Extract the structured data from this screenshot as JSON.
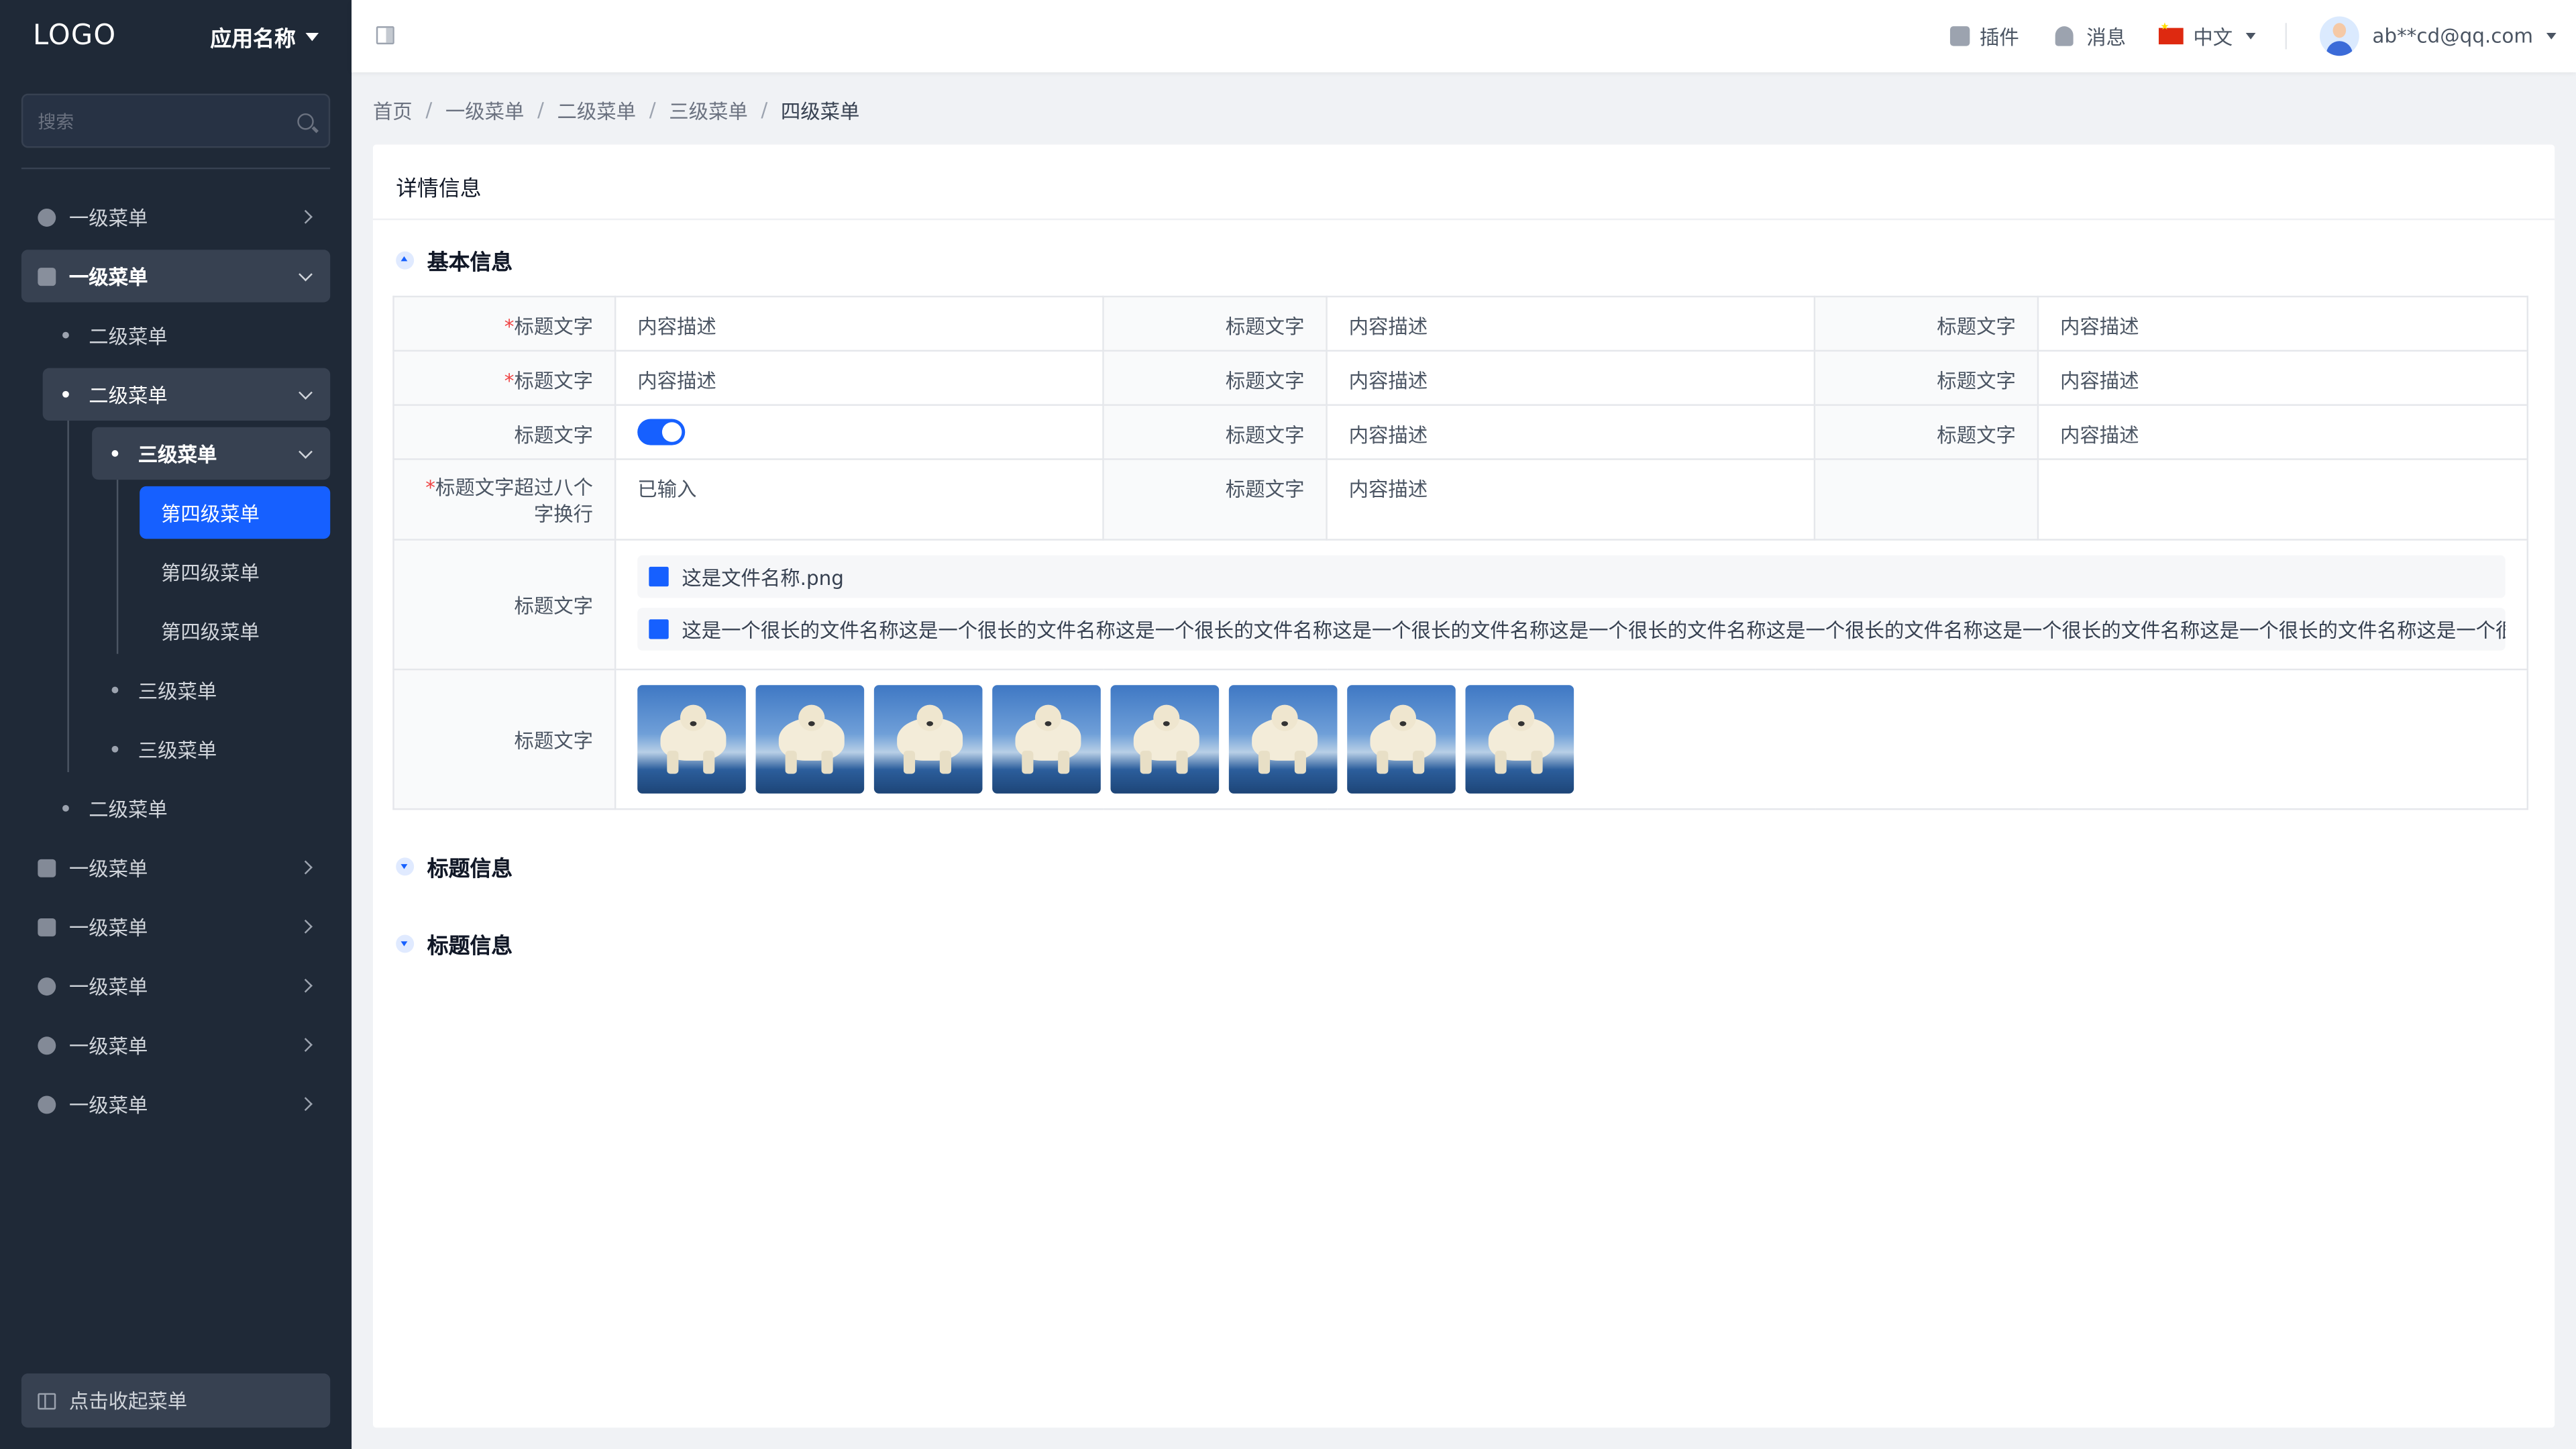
{
  "sidebar": {
    "logo": "LOGO",
    "app_name": "应用名称",
    "search_placeholder": "搜索",
    "items": [
      {
        "label": "一级菜单"
      },
      {
        "label": "一级菜单"
      },
      {
        "label": "二级菜单"
      },
      {
        "label": "二级菜单"
      },
      {
        "label": "三级菜单"
      },
      {
        "label": "第四级菜单"
      },
      {
        "label": "第四级菜单"
      },
      {
        "label": "第四级菜单"
      },
      {
        "label": "三级菜单"
      },
      {
        "label": "三级菜单"
      },
      {
        "label": "二级菜单"
      },
      {
        "label": "一级菜单"
      },
      {
        "label": "一级菜单"
      },
      {
        "label": "一级菜单"
      },
      {
        "label": "一级菜单"
      },
      {
        "label": "一级菜单"
      }
    ],
    "collapse_label": "点击收起菜单"
  },
  "header": {
    "plugins": "插件",
    "messages": "消息",
    "language": "中文",
    "user": "ab**cd@qq.com"
  },
  "breadcrumb": [
    "首页",
    "一级菜单",
    "二级菜单",
    "三级菜单",
    "四级菜单"
  ],
  "card": {
    "title": "详情信息",
    "section_basic": "基本信息",
    "section_2": "标题信息",
    "section_3": "标题信息",
    "rows": [
      {
        "l1": "标题文字",
        "v1": "内容描述",
        "l2": "标题文字",
        "v2": "内容描述",
        "l3": "标题文字",
        "v3": "内容描述"
      },
      {
        "l1": "标题文字",
        "v1": "内容描述",
        "l2": "标题文字",
        "v2": "内容描述",
        "l3": "标题文字",
        "v3": "内容描述"
      },
      {
        "l1": "标题文字",
        "l2": "标题文字",
        "v2": "内容描述",
        "l3": "标题文字",
        "v3": "内容描述"
      },
      {
        "l1": "标题文字超过八个字换行",
        "v1": "已输入",
        "l2": "标题文字",
        "v2": "内容描述"
      }
    ],
    "files_label": "标题文字",
    "files": [
      "这是文件名称.png",
      "这是一个很长的文件名称这是一个很长的文件名称这是一个很长的文件名称这是一个很长的文件名称这是一个很长的文件名称这是一个很长的文件名称这是一个很长的文件名称这是一个很长的文件名称这是一个很....png"
    ],
    "images_label": "标题文字",
    "image_count": 8
  },
  "colors": {
    "sidebar_bg": "#1f2937",
    "accent": "#1660ff",
    "required": "#ef4444"
  }
}
